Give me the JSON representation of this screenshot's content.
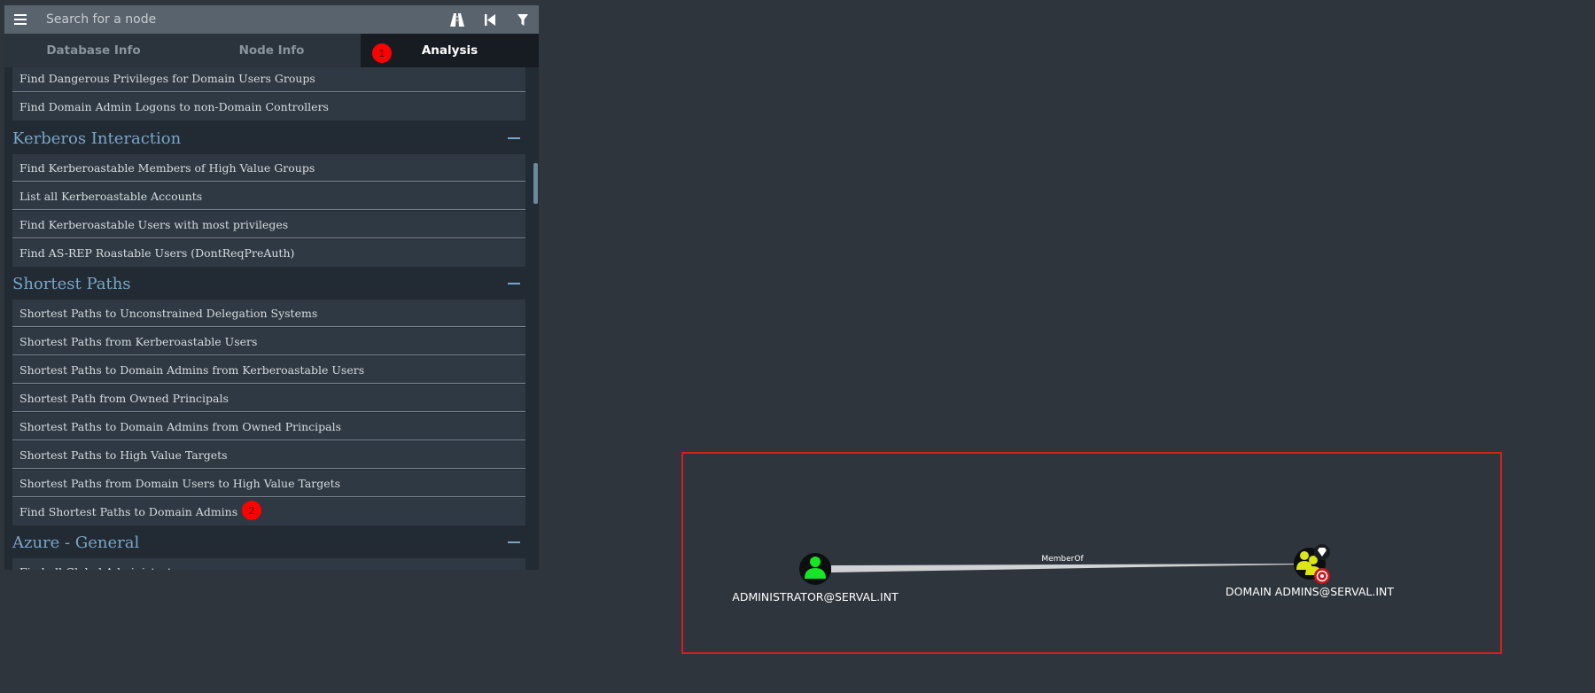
{
  "search": {
    "placeholder": "Search for a node"
  },
  "toolbar": {
    "menu_icon": "hamburger-icon",
    "icons": [
      "pathfinding-icon",
      "back-icon",
      "filter-icon"
    ]
  },
  "tabs": [
    {
      "label": "Database Info",
      "active": false
    },
    {
      "label": "Node Info",
      "active": false
    },
    {
      "label": "Analysis",
      "active": true
    }
  ],
  "queries": {
    "top_items": [
      "Find Dangerous Privileges for Domain Users Groups",
      "Find Domain Admin Logons to non-Domain Controllers"
    ],
    "sections": [
      {
        "title": "Kerberos Interaction",
        "items": [
          "Find Kerberoastable Members of High Value Groups",
          "List all Kerberoastable Accounts",
          "Find Kerberoastable Users with most privileges",
          "Find AS-REP Roastable Users (DontReqPreAuth)"
        ]
      },
      {
        "title": "Shortest Paths",
        "items": [
          "Shortest Paths to Unconstrained Delegation Systems",
          "Shortest Paths from Kerberoastable Users",
          "Shortest Paths to Domain Admins from Kerberoastable Users",
          "Shortest Path from Owned Principals",
          "Shortest Paths to Domain Admins from Owned Principals",
          "Shortest Paths to High Value Targets",
          "Shortest Paths from Domain Users to High Value Targets",
          "Find Shortest Paths to Domain Admins"
        ]
      },
      {
        "title": "Azure - General",
        "items": [
          "Find all Global Administrators"
        ]
      }
    ]
  },
  "markers": [
    "1",
    "2"
  ],
  "graph": {
    "nodes": [
      {
        "label": "ADMINISTRATOR@SERVAL.INT",
        "type": "user",
        "icon": "user-icon",
        "color": "#17e625"
      },
      {
        "label": "DOMAIN ADMINS@SERVAL.INT",
        "type": "group",
        "icon": "group-icon",
        "color": "#dbe617",
        "badges": [
          "high-value-diamond-icon",
          "target-icon"
        ]
      }
    ],
    "edges": [
      {
        "from": "ADMINISTRATOR@SERVAL.INT",
        "to": "DOMAIN ADMINS@SERVAL.INT",
        "label": "MemberOf"
      }
    ],
    "highlight_color": "#d21f1f"
  }
}
